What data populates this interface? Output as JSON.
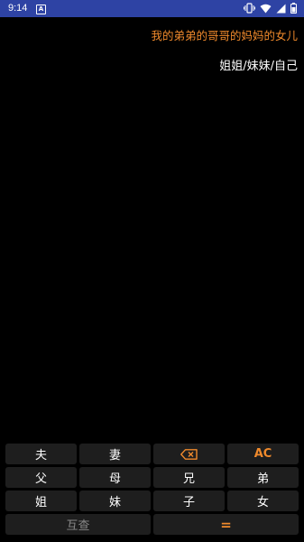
{
  "status_bar": {
    "time": "9:14",
    "notification_icon_label": "A",
    "icons": [
      "vibrate-icon",
      "wifi-icon",
      "signal-icon",
      "battery-icon"
    ],
    "background_color": "#2E43A4"
  },
  "display": {
    "expression": "我的弟弟的哥哥的妈妈的女儿",
    "result": "姐姐/妹妹/自己",
    "expression_color": "#F08A2C",
    "result_color": "#FFFFFF"
  },
  "keypad": {
    "row1": {
      "husband": "夫",
      "wife": "妻",
      "backspace_icon": "backspace-icon",
      "clear": "AC"
    },
    "row2": {
      "father": "父",
      "mother": "母",
      "elder_brother": "兄",
      "younger_brother": "弟"
    },
    "row3": {
      "elder_sister": "姐",
      "younger_sister": "妹",
      "son": "子",
      "daughter": "女"
    },
    "row4": {
      "mutual": "互查",
      "equals": "="
    },
    "accent_color": "#F08A2C",
    "key_color": "#1E1E1E"
  }
}
